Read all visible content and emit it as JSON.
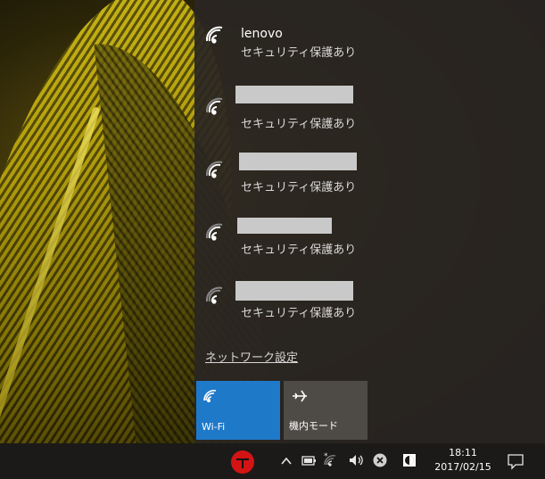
{
  "networks": [
    {
      "name": "lenovo",
      "status": "セキュリティ保護あり",
      "redacted": false
    },
    {
      "name": "",
      "status": "セキュリティ保護あり",
      "redacted": true
    },
    {
      "name": "",
      "status": "セキュリティ保護あり",
      "redacted": true
    },
    {
      "name": "",
      "status": "セキュリティ保護あり",
      "redacted": true
    },
    {
      "name": "",
      "status": "セキュリティ保護あり",
      "redacted": true
    }
  ],
  "settings_link": "ネットワーク設定",
  "quick_actions": {
    "wifi_label": "Wi-Fi",
    "airplane_label": "機内モード"
  },
  "taskbar": {
    "time": "18:11",
    "date": "2017/02/15"
  },
  "icons": {
    "wifi": "wifi-icon",
    "airplane": "airplane-icon",
    "app": "red-app-icon",
    "chevron": "chevron-up-icon",
    "battery": "battery-icon",
    "network": "wifi-tray-icon",
    "volume": "volume-icon",
    "close": "close-circle-icon",
    "clock_app": "clock-app-icon",
    "notifications": "notification-icon"
  },
  "colors": {
    "accent": "#1f79c9",
    "flyout_bg": "#2a2622",
    "taskbar_bg": "#1b1a18"
  }
}
